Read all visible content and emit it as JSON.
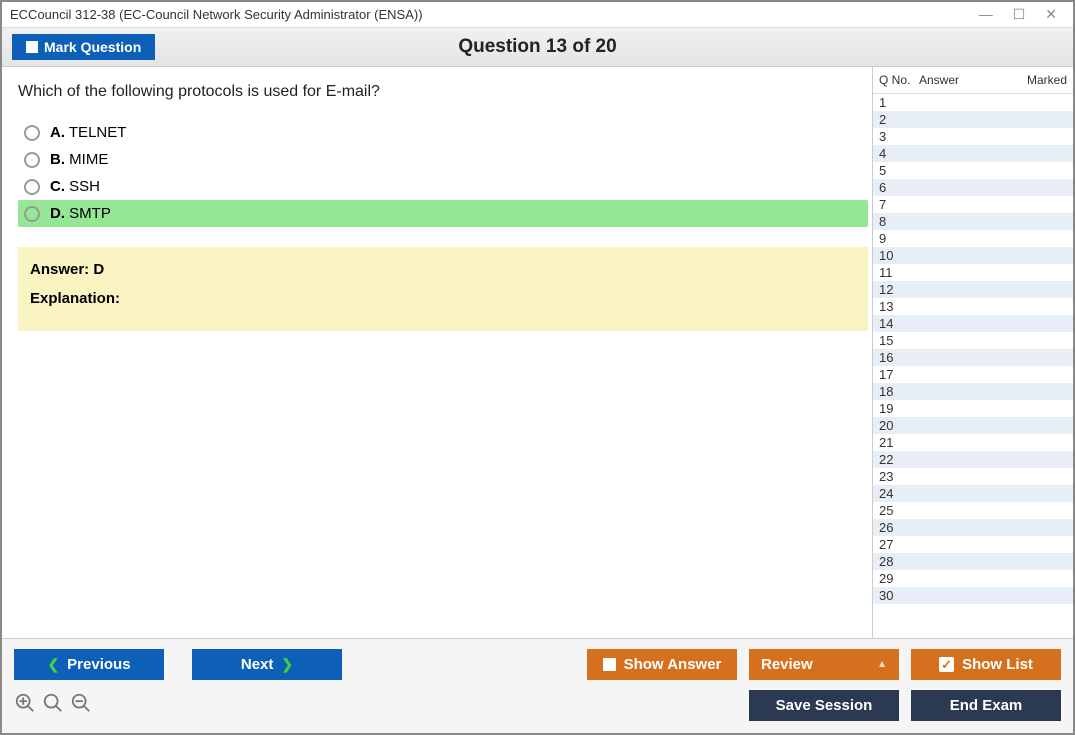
{
  "window": {
    "title": "ECCouncil 312-38 (EC-Council Network Security Administrator (ENSA))"
  },
  "header": {
    "mark_button": "Mark Question",
    "counter": "Question 13 of 20"
  },
  "question": {
    "text": "Which of the following protocols is used for E-mail?",
    "options": [
      {
        "letter": "A.",
        "text": "TELNET",
        "correct": false
      },
      {
        "letter": "B.",
        "text": "MIME",
        "correct": false
      },
      {
        "letter": "C.",
        "text": "SSH",
        "correct": false
      },
      {
        "letter": "D.",
        "text": "SMTP",
        "correct": true
      }
    ],
    "answer_label": "Answer:",
    "answer_value": "D",
    "explanation_label": "Explanation:"
  },
  "side": {
    "col_qno": "Q No.",
    "col_answer": "Answer",
    "col_marked": "Marked",
    "rows": [
      1,
      2,
      3,
      4,
      5,
      6,
      7,
      8,
      9,
      10,
      11,
      12,
      13,
      14,
      15,
      16,
      17,
      18,
      19,
      20,
      21,
      22,
      23,
      24,
      25,
      26,
      27,
      28,
      29,
      30
    ]
  },
  "footer": {
    "previous": "Previous",
    "next": "Next",
    "show_answer": "Show Answer",
    "review": "Review",
    "show_list": "Show List",
    "save_session": "Save Session",
    "end_exam": "End Exam"
  }
}
